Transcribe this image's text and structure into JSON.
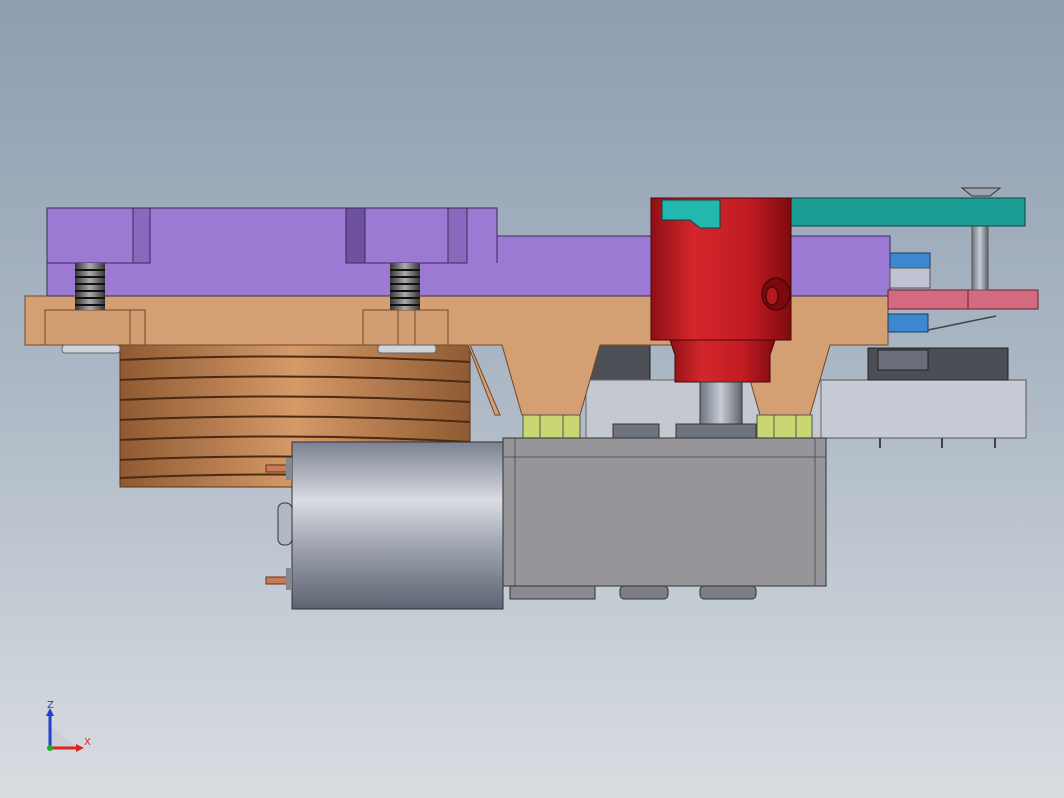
{
  "view": {
    "colors": {
      "background_top": "#8e9db0",
      "background_bottom": "#d9dde2",
      "top_plate": "#9c79d2",
      "base_plate": "#d4a073",
      "coil": "#b57a4a",
      "motor_can": "#9ea3ad",
      "gearbox": "#96969a",
      "cylinder": "#c21b22",
      "teal_arm": "#1a9e96",
      "pink_lever": "#d46a80",
      "blue_block": "#3d86d0",
      "nut": "#c9d672",
      "switch_body": "#c7cbd5",
      "axis_x": "#d22",
      "axis_y": "#2a2",
      "axis_z": "#2240c8"
    }
  },
  "triad": {
    "z_label": "Z",
    "x_label": "X"
  }
}
